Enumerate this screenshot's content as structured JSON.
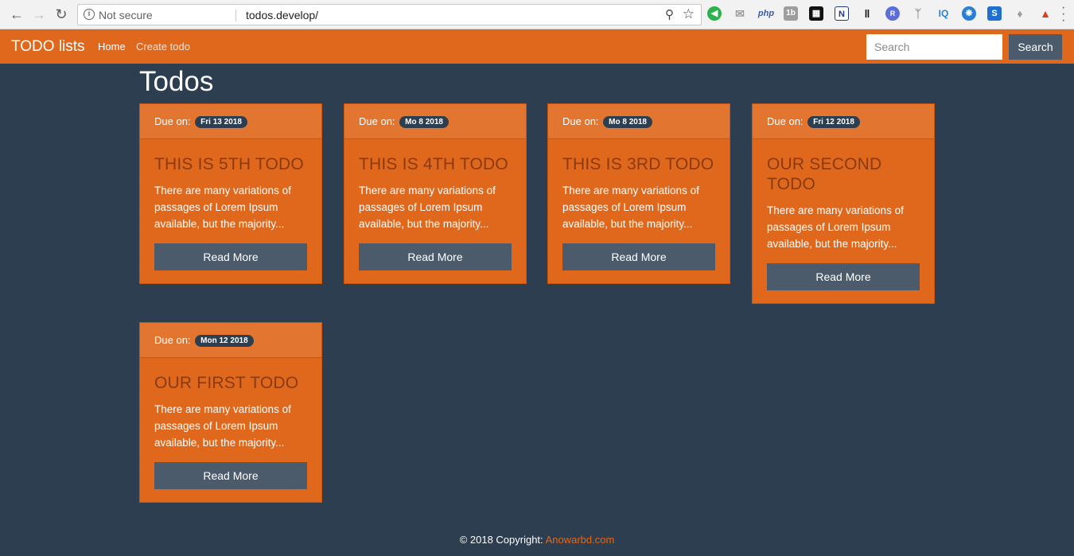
{
  "browser": {
    "security_label": "Not secure",
    "url": "todos.develop/",
    "extensions": [
      "php",
      "1b",
      "N",
      "R",
      "IQ",
      "S"
    ]
  },
  "navbar": {
    "brand": "TODO lists",
    "home": "Home",
    "create": "Create todo",
    "search_placeholder": "Search",
    "search_button": "Search"
  },
  "page": {
    "title": "Todos"
  },
  "todos": [
    {
      "due_label": "Due on:",
      "due": "Fri 13 2018",
      "title": "This is 5th todo",
      "excerpt": "There are many variations of passages of Lorem Ipsum available, but the majority...",
      "button": "Read More"
    },
    {
      "due_label": "Due on:",
      "due": "Mo 8 2018",
      "title": "This is 4th todo",
      "excerpt": "There are many variations of passages of Lorem Ipsum available, but the majority...",
      "button": "Read More"
    },
    {
      "due_label": "Due on:",
      "due": "Mo 8 2018",
      "title": "This is 3rd todo",
      "excerpt": "There are many variations of passages of Lorem Ipsum available, but the majority...",
      "button": "Read More"
    },
    {
      "due_label": "Due on:",
      "due": "Fri 12 2018",
      "title": "Our second todo",
      "excerpt": "There are many variations of passages of Lorem Ipsum available, but the majority...",
      "button": "Read More"
    },
    {
      "due_label": "Due on:",
      "due": "Mon 12 2018",
      "title": "Our first todo",
      "excerpt": "There are many variations of passages of Lorem Ipsum available, but the majority...",
      "button": "Read More"
    }
  ],
  "footer": {
    "copyright": "© 2018 Copyright:",
    "link": "Anowarbd.com"
  },
  "colors": {
    "accent": "#e0681c",
    "background": "#2c3e50",
    "button": "#4b5b6c"
  }
}
